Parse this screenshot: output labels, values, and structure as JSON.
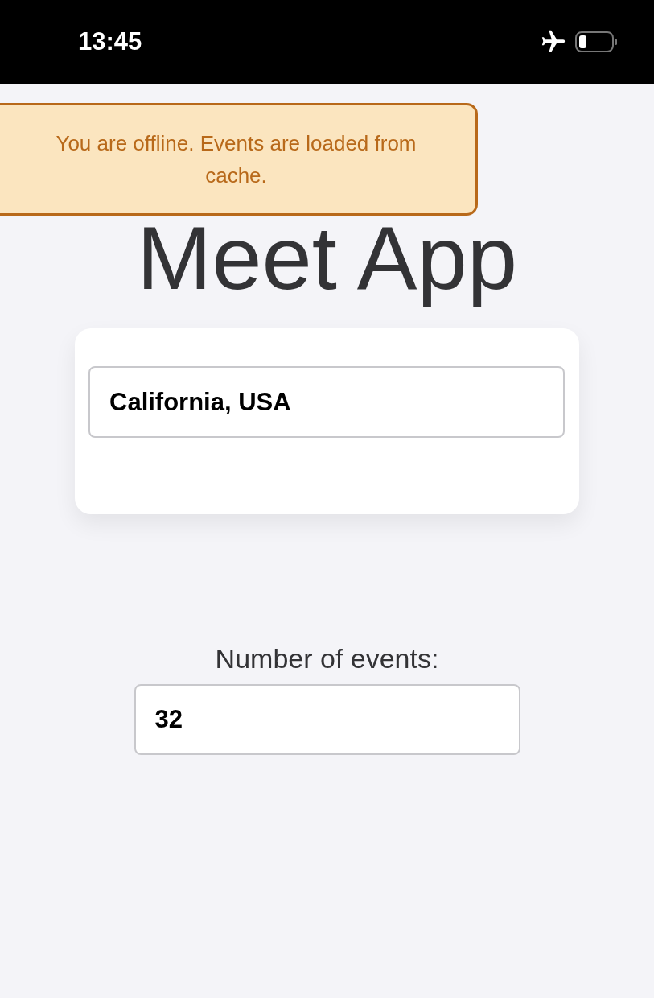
{
  "status_bar": {
    "time": "13:45",
    "airplane_mode": true
  },
  "offline_alert": {
    "text": "You are offline. Events are loaded from cache."
  },
  "title": "Meet App",
  "city_search": {
    "value": "California, USA"
  },
  "number_of_events": {
    "label": "Number of events:",
    "value": "32"
  }
}
